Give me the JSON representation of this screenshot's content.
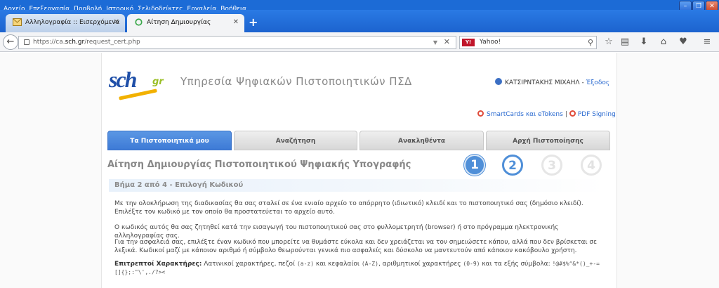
{
  "menu": [
    "Αρχείο",
    "Επεξεργασία",
    "Προβολή",
    "Ιστορικό",
    "Σελιδοδείκτες",
    "Εργαλεία",
    "Βοήθεια"
  ],
  "tabs": [
    {
      "label": "Αλληλογραφία :: Εισερχόμενα"
    },
    {
      "label": "Αίτηση Δημιουργίας Πιστοποιη..."
    }
  ],
  "address": {
    "prefix": "https://ca.",
    "host": "sch.gr",
    "path": "/request_cert.php"
  },
  "search": {
    "engine_badge": "Y!",
    "placeholder": "Yahoo!"
  },
  "site": {
    "logo_text": "sch",
    "logo_suffix": "gr",
    "service_title": "Υπηρεσία Ψηφιακών Πιστοποιητικών ΠΣΔ",
    "user_name": "ΚΑΤΣΙΡΝΤΑΚΗΣ ΜΙΧΑΗΛ",
    "logout": "Έξοδος",
    "link_smartcards": "SmartCards και eTokens",
    "link_pdf": "PDF Signing"
  },
  "nav_tabs": [
    "Τα Πιστοποιητικά μου",
    "Αναζήτηση",
    "Ανακληθέντα",
    "Αρχή Πιστοποίησης"
  ],
  "page_heading": "Αίτηση Δημιουργίας Πιστοποιητικού Ψηφιακής Υπογραφής",
  "steps": [
    "1",
    "2",
    "3",
    "4"
  ],
  "step_subhead": "Βήμα 2 από 4 - Επιλογή Κωδικού",
  "paragraphs": {
    "p1": "Με την ολοκλήρωση της διαδικασίας θα σας σταλεί σε ένα ενιαίο αρχείο το απόρρητο (ιδιωτικό) κλειδί και το πιστοποιητικό σας (δημόσιο κλειδί). Επιλέξτε τον κωδικό με τον οποίο θα προστατεύεται το αρχείο αυτό.",
    "p2": "Ο κωδικός αυτός θα σας ζητηθεί κατά την εισαγωγή του πιστοποιητικού σας στο φυλλομετρητή (browser) ή στο πρόγραμμα ηλεκτρονικής αλληλογραφίας σας.",
    "p3": "Για την ασφαλειά σας, επιλέξτε έναν κωδικό που μπορείτε να θυμάστε εύκολα και δεν χρειάζεται να τον σημειώσετε κάπου, αλλά που δεν βρίσκεται σε λεξικά. Κωδικοί μαζί με κάποιον αριθμό ή σύμβολο θεωρούνται γενικά πιο ασφαλείς και δύσκολο να μαντευτούν από κάποιον κακόβουλο χρήστη.",
    "allowed_label": "Επιτρεπτοί Χαρακτήρες:",
    "allowed_a": "Λατινικοί χαρακτήρες, πεζοί",
    "allowed_lower": "(a-z)",
    "allowed_b": "και κεφαλαίοι",
    "allowed_upper": "(A-Z)",
    "allowed_c": ", αριθμητικοί χαρακτήρες",
    "allowed_digits": "(0-9)",
    "allowed_d": "και τα εξής σύμβολα:",
    "allowed_symbols": "!@#$%^&*()_+-=[]{};:\"\\',./?><"
  }
}
